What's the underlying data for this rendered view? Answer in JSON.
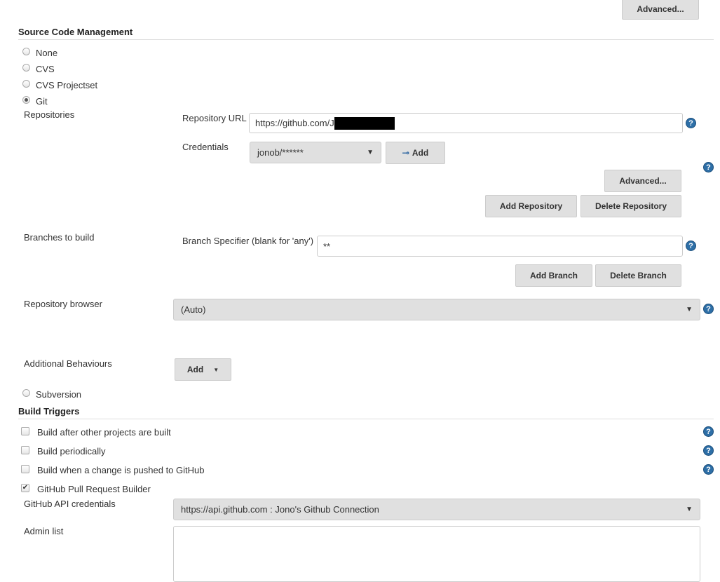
{
  "top_advanced": "Advanced...",
  "scm": {
    "title": "Source Code Management",
    "options": [
      {
        "label": "None",
        "checked": false
      },
      {
        "label": "CVS",
        "checked": false
      },
      {
        "label": "CVS Projectset",
        "checked": false
      },
      {
        "label": "Git",
        "checked": true
      }
    ],
    "repositories_label": "Repositories",
    "repo_url_label": "Repository URL",
    "repo_url_value": "https://github.com/J",
    "credentials_label": "Credentials",
    "credentials_value": "jonob/******",
    "credentials_add": "Add",
    "advanced": "Advanced...",
    "add_repository": "Add Repository",
    "delete_repository": "Delete Repository",
    "branches_label": "Branches to build",
    "branch_spec_label": "Branch Specifier (blank for 'any')",
    "branch_spec_value": "**",
    "add_branch": "Add Branch",
    "delete_branch": "Delete Branch",
    "repo_browser_label": "Repository browser",
    "repo_browser_value": "(Auto)",
    "additional_label": "Additional Behaviours",
    "additional_add": "Add",
    "subversion": "Subversion"
  },
  "triggers": {
    "title": "Build Triggers",
    "options": [
      {
        "label": "Build after other projects are built",
        "checked": false
      },
      {
        "label": "Build periodically",
        "checked": false
      },
      {
        "label": "Build when a change is pushed to GitHub",
        "checked": false
      },
      {
        "label": "GitHub Pull Request Builder",
        "checked": true
      }
    ],
    "api_credentials_label": "GitHub API credentials",
    "api_credentials_value": "https://api.github.com : Jono's Github Connection",
    "admin_list_label": "Admin list",
    "admin_list_value": ""
  },
  "help": "?"
}
